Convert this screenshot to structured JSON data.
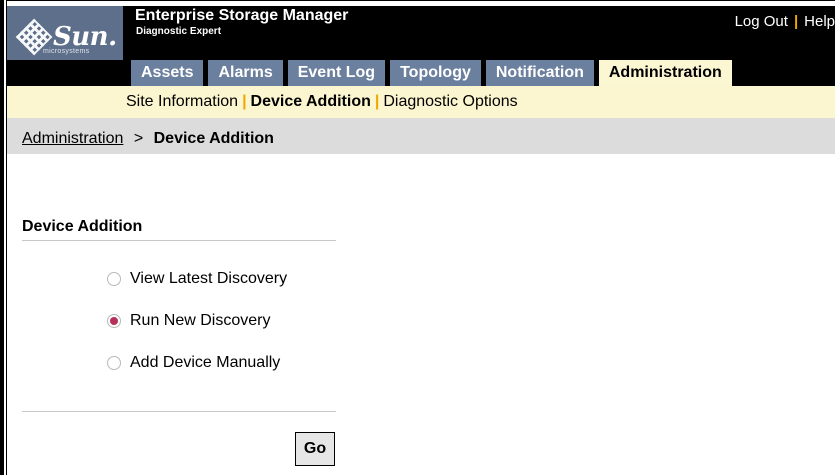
{
  "masthead": {
    "logo_text": "Sun.",
    "logo_subtext": "microsystems",
    "app_title": "Enterprise Storage Manager",
    "app_subtitle": "Diagnostic Expert",
    "logout_label": "Log Out",
    "separator": "|",
    "help_label": "Help"
  },
  "tabs": [
    {
      "label": "Assets",
      "active": false
    },
    {
      "label": "Alarms",
      "active": false
    },
    {
      "label": "Event Log",
      "active": false
    },
    {
      "label": "Topology",
      "active": false
    },
    {
      "label": "Notification",
      "active": false
    },
    {
      "label": "Administration",
      "active": true
    }
  ],
  "subnav": {
    "items": [
      {
        "label": "Site Information",
        "active": false
      },
      {
        "label": "Device Addition",
        "active": true
      },
      {
        "label": "Diagnostic Options",
        "active": false
      }
    ],
    "separator": "|"
  },
  "breadcrumb": {
    "parent": "Administration",
    "separator": ">",
    "current": "Device Addition"
  },
  "content": {
    "section_title": "Device Addition",
    "options": [
      {
        "label": "View Latest Discovery",
        "selected": false
      },
      {
        "label": "Run New Discovery",
        "selected": true
      },
      {
        "label": "Add Device Manually",
        "selected": false
      }
    ],
    "go_label": "Go"
  },
  "colors": {
    "tab_bg": "#6b7f9e",
    "active_tab_bg": "#fbf7d2",
    "subnav_bg": "#fbf6cf",
    "crumb_bg": "#dcdcdc",
    "separator_accent": "#f0a800",
    "radio_selected": "#b6315a"
  }
}
